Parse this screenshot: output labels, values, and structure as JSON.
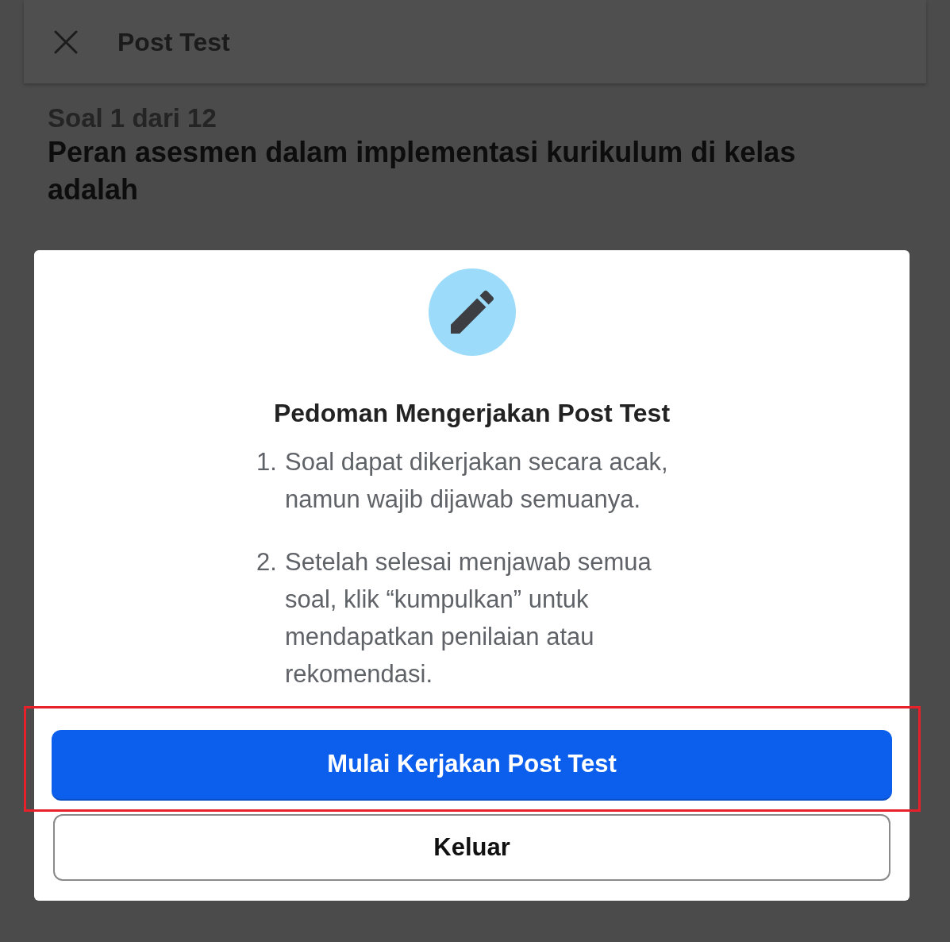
{
  "header": {
    "title": "Post Test"
  },
  "question": {
    "counter": "Soal 1 dari 12",
    "text": "Peran asesmen dalam implementasi kurikulum di kelas adalah"
  },
  "dialog": {
    "title": "Pedoman Mengerjakan Post Test",
    "guidelines": [
      {
        "number": "1.",
        "text": "Soal dapat dikerjakan secara acak, namun wajib dijawab semuanya."
      },
      {
        "number": "2.",
        "text": "Setelah selesai menjawab semua soal, klik “kumpulkan” untuk mendapatkan penilaian atau rekomendasi."
      }
    ],
    "buttons": [
      {
        "label": "Mulai Kerjakan Post Test",
        "kind": "primary",
        "highlighted": true
      },
      {
        "label": "Keluar",
        "kind": "secondary",
        "highlighted": false
      }
    ]
  }
}
